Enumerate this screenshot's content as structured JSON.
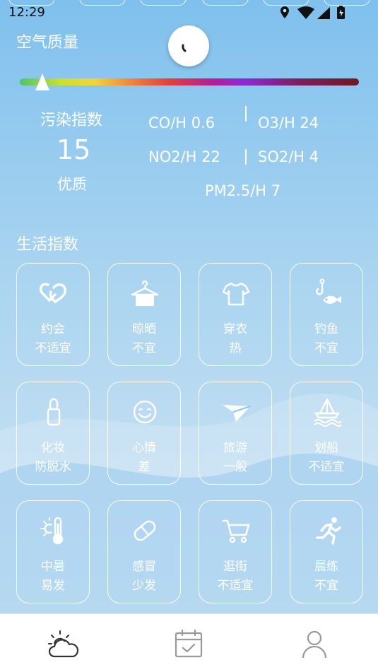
{
  "status_bar": {
    "time": "12:29"
  },
  "air_quality": {
    "title": "空气质量",
    "index_label": "污染指数",
    "index_value": "15",
    "level": "优质",
    "pollutants": {
      "co": "CO/H  0.6",
      "o3": "O3/H  24",
      "no2": "NO2/H  22",
      "so2": "SO2/H  4",
      "pm25": "PM2.5/H  7"
    }
  },
  "life_index": {
    "title": "生活指数",
    "items": [
      {
        "name": "约会",
        "value": "不适宜",
        "icon": "hearts-icon"
      },
      {
        "name": "晾晒",
        "value": "不宜",
        "icon": "hanger-icon"
      },
      {
        "name": "穿衣",
        "value": "热",
        "icon": "tshirt-icon"
      },
      {
        "name": "钓鱼",
        "value": "不宜",
        "icon": "fish-hook-icon"
      },
      {
        "name": "化妆",
        "value": "防脱水",
        "icon": "lipstick-icon"
      },
      {
        "name": "心情",
        "value": "差",
        "icon": "smiley-icon"
      },
      {
        "name": "旅游",
        "value": "一般",
        "icon": "paper-plane-icon"
      },
      {
        "name": "划船",
        "value": "不适宜",
        "icon": "sailboat-icon"
      },
      {
        "name": "中暑",
        "value": "易发",
        "icon": "thermometer-sun-icon"
      },
      {
        "name": "感冒",
        "value": "少发",
        "icon": "pill-icon"
      },
      {
        "name": "逛街",
        "value": "不适宜",
        "icon": "shopping-cart-icon"
      },
      {
        "name": "晨练",
        "value": "不宜",
        "icon": "runner-icon"
      }
    ]
  },
  "nav": {
    "items": [
      {
        "icon": "weather-cloud-sun-icon",
        "active": true
      },
      {
        "icon": "calendar-check-icon",
        "active": false
      },
      {
        "icon": "user-profile-icon",
        "active": false
      }
    ]
  },
  "colors": {
    "tile_border": "#ffffff",
    "nav_icon": "#999999",
    "nav_active": "#333333"
  }
}
